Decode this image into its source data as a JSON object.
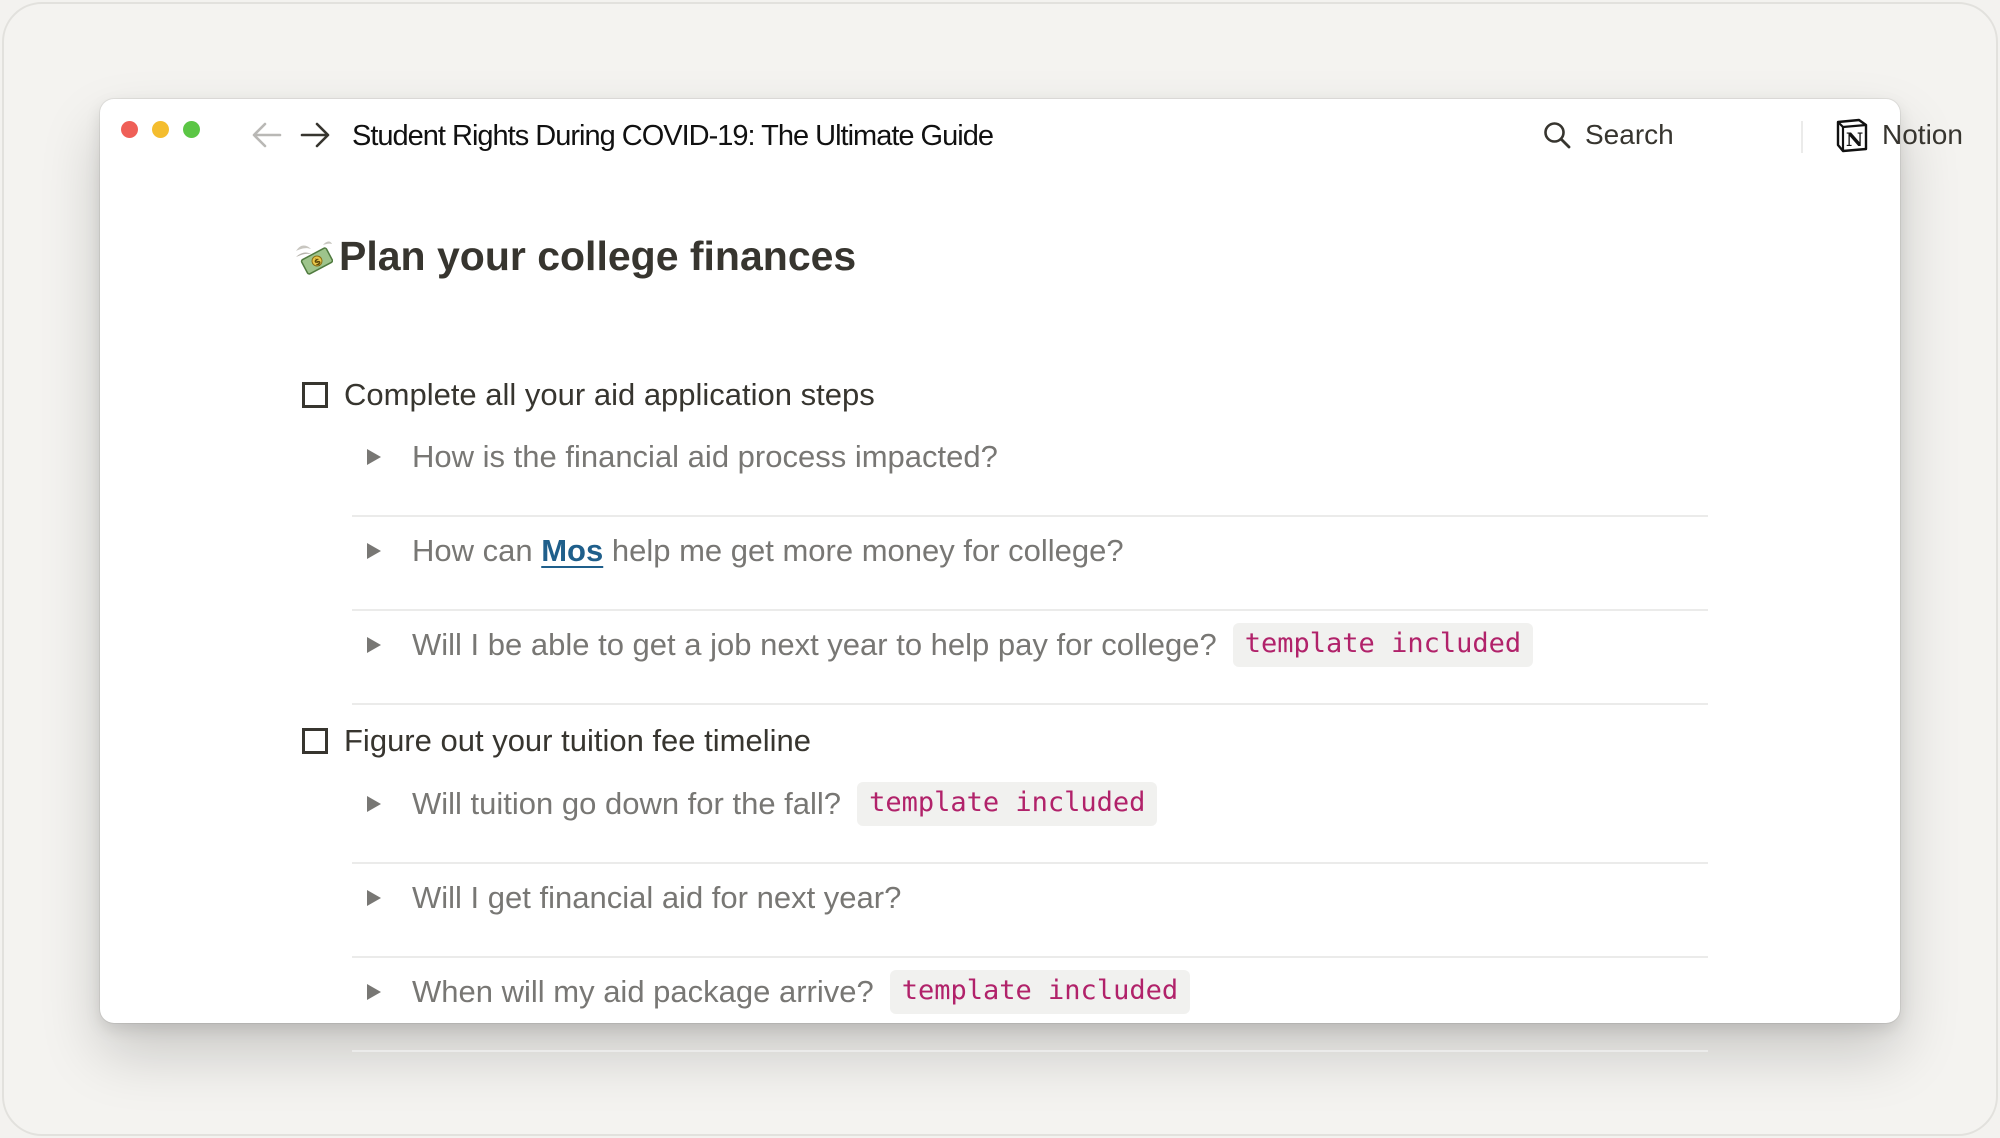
{
  "window": {
    "title": "Student Rights During COVID-19: The Ultimate Guide",
    "search_label": "Search",
    "notion_label": "Notion",
    "traffic_lights": {
      "close": "#ef5f57",
      "minimize": "#f4bd2f",
      "zoom": "#5bc645"
    }
  },
  "page": {
    "heading": "Plan your college finances",
    "heading_icon": "money-with-wings-icon",
    "todos": [
      {
        "label": "Complete all your aid application steps",
        "checked": false,
        "toggles": [
          {
            "text": "How is the financial aid process impacted?",
            "tag": ""
          },
          {
            "text_before": "How can ",
            "link": "Mos",
            "text_after": " help me get more money for college?",
            "tag": ""
          },
          {
            "text": "Will I be able to get a job next year to help pay for college?",
            "tag": "template included"
          }
        ]
      },
      {
        "label": "Figure out your tuition fee timeline",
        "checked": false,
        "toggles": [
          {
            "text": "Will tuition go down for the fall?",
            "tag": "template included"
          },
          {
            "text": "Will I get financial aid for next year?",
            "tag": ""
          },
          {
            "text": "When will my aid package arrive?",
            "tag": "template included"
          }
        ]
      }
    ]
  },
  "colors": {
    "text": "#37352f",
    "muted_text": "#787774",
    "link": "#1f5f8b",
    "code_text": "#b1226a",
    "code_bg": "#f1f1ef"
  }
}
